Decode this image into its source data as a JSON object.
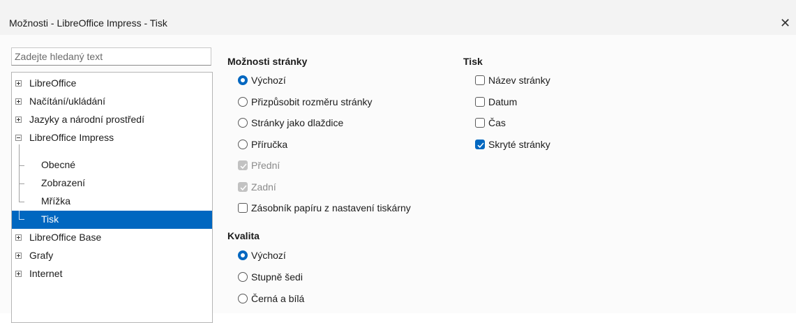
{
  "window": {
    "title": "Možnosti - LibreOffice Impress - Tisk",
    "close_glyph": "✕"
  },
  "search": {
    "placeholder": "Zadejte hledaný text"
  },
  "tree": {
    "items": [
      {
        "label": "LibreOffice",
        "expanded": false
      },
      {
        "label": "Načítání/ukládání",
        "expanded": false
      },
      {
        "label": "Jazyky a národní prostředí",
        "expanded": false
      },
      {
        "label": "LibreOffice Impress",
        "expanded": true
      },
      {
        "label": "Obecné"
      },
      {
        "label": "Zobrazení"
      },
      {
        "label": "Mřížka"
      },
      {
        "label": "Tisk",
        "selected": true
      },
      {
        "label": "LibreOffice Base",
        "expanded": false
      },
      {
        "label": "Grafy",
        "expanded": false
      },
      {
        "label": "Internet",
        "expanded": false
      }
    ]
  },
  "page_options": {
    "title": "Možnosti stránky",
    "options": [
      {
        "label": "Výchozí",
        "type": "radio",
        "checked": true
      },
      {
        "label": "Přizpůsobit rozměru stránky",
        "type": "radio",
        "checked": false
      },
      {
        "label": "Stránky jako dlaždice",
        "type": "radio",
        "checked": false
      },
      {
        "label": "Příručka",
        "type": "radio",
        "checked": false
      },
      {
        "label": "Přední",
        "type": "checkbox",
        "checked": true,
        "disabled": true
      },
      {
        "label": "Zadní",
        "type": "checkbox",
        "checked": true,
        "disabled": true
      },
      {
        "label": "Zásobník papíru z nastavení tiskárny",
        "type": "checkbox",
        "checked": false
      }
    ]
  },
  "quality": {
    "title": "Kvalita",
    "options": [
      {
        "label": "Výchozí",
        "checked": true
      },
      {
        "label": "Stupně šedi",
        "checked": false
      },
      {
        "label": "Černá a bílá",
        "checked": false
      }
    ]
  },
  "print": {
    "title": "Tisk",
    "options": [
      {
        "label": "Název stránky",
        "checked": false
      },
      {
        "label": "Datum",
        "checked": false
      },
      {
        "label": "Čas",
        "checked": false
      },
      {
        "label": "Skryté stránky",
        "checked": true
      }
    ]
  },
  "colors": {
    "accent": "#0067c0",
    "selected_row": "#0067c0"
  }
}
